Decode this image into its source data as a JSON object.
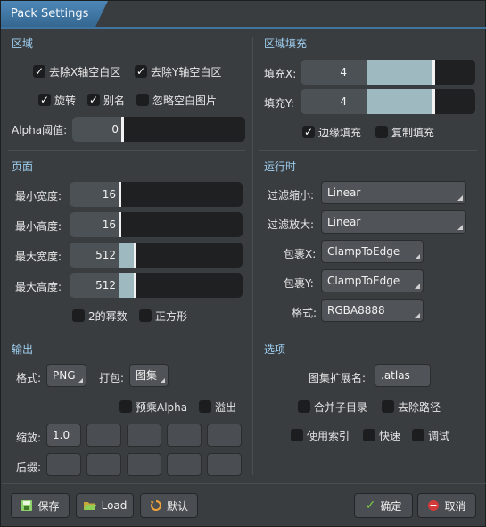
{
  "window": {
    "title": "Pack Settings"
  },
  "region": {
    "title": "区域",
    "strip_x": {
      "label": "去除X轴空白区",
      "checked": true
    },
    "strip_y": {
      "label": "去除Y轴空白区",
      "checked": true
    },
    "rotate": {
      "label": "旋转",
      "checked": true
    },
    "alias": {
      "label": "别名",
      "checked": true
    },
    "ignore_blank": {
      "label": "忽略空白图片",
      "checked": false
    },
    "alpha_label": "Alpha阈值:",
    "alpha_value": "0"
  },
  "region_fill": {
    "title": "区域填充",
    "fill_x_label": "填充X:",
    "fill_x_value": "4",
    "fill_y_label": "填充Y:",
    "fill_y_value": "4",
    "edge_padding": {
      "label": "边缘填充",
      "checked": true
    },
    "duplicate_padding": {
      "label": "复制填充",
      "checked": false
    }
  },
  "page": {
    "title": "页面",
    "min_width_label": "最小宽度:",
    "min_width": "16",
    "min_height_label": "最小高度:",
    "min_height": "16",
    "max_width_label": "最大宽度:",
    "max_width": "512",
    "max_height_label": "最大高度:",
    "max_height": "512",
    "pot": {
      "label": "2的幂数",
      "checked": false
    },
    "square": {
      "label": "正方形",
      "checked": false
    }
  },
  "runtime": {
    "title": "运行时",
    "filter_min_label": "过滤缩小:",
    "filter_min": "Linear",
    "filter_mag_label": "过滤放大:",
    "filter_mag": "Linear",
    "wrap_x_label": "包裹X:",
    "wrap_x": "ClampToEdge",
    "wrap_y_label": "包裹Y:",
    "wrap_y": "ClampToEdge",
    "format_label": "格式:",
    "format": "RGBA8888"
  },
  "output": {
    "title": "输出",
    "format_label": "格式:",
    "format": "PNG",
    "pack_label": "打包:",
    "pack": "图集",
    "premultiply": {
      "label": "预乘Alpha",
      "checked": false
    },
    "bleed": {
      "label": "溢出",
      "checked": false
    },
    "scale_label": "缩放:",
    "scale_values": [
      "1.0",
      "",
      "",
      "",
      ""
    ],
    "suffix_label": "后缀:",
    "suffix_values": [
      "",
      "",
      "",
      "",
      ""
    ]
  },
  "options": {
    "title": "选项",
    "atlas_ext_label": "图集扩展名:",
    "atlas_ext": ".atlas",
    "flatten": {
      "label": "合并子目录",
      "checked": false
    },
    "strip_path": {
      "label": "去除路径",
      "checked": false
    },
    "use_index": {
      "label": "使用索引",
      "checked": false
    },
    "fast": {
      "label": "快速",
      "checked": false
    },
    "debug": {
      "label": "调试",
      "checked": false
    }
  },
  "footer": {
    "save": "保存",
    "load": "Load",
    "default": "默认",
    "ok": "确定",
    "cancel": "取消"
  },
  "colors": {
    "accent": "#4d87b8",
    "section_title": "#9ecff0",
    "ok_icon": "#7bd13e",
    "cancel_icon": "#d23a3a"
  }
}
